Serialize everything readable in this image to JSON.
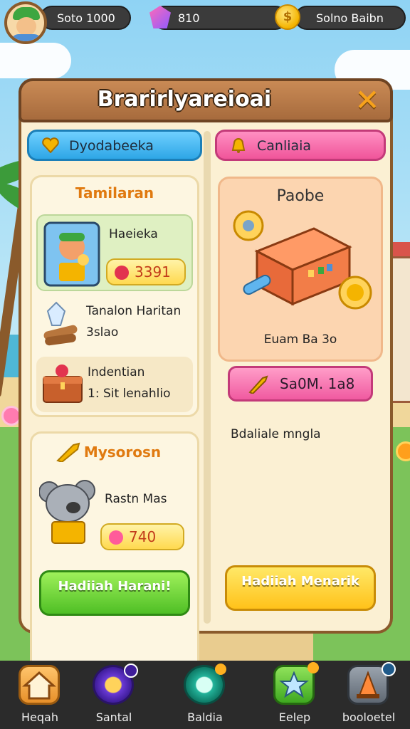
{
  "topbar": {
    "player_name": "Soto 1000",
    "gems": "810",
    "coins": "Solno Baibn"
  },
  "panel": {
    "title": "Brarirlyareioai",
    "close_label": "✕"
  },
  "left": {
    "tab_label": "Dyodabeeka",
    "section1_title": "Tamilaran",
    "item1_name": "Haeieka",
    "item1_price": "3391",
    "item2_name": "Tanalon Haritan",
    "item2_sub": "3slao",
    "item3_name": "Indentian",
    "item3_sub": "1: Sit lenahlio",
    "section2_title": "Mysorosn",
    "item4_name": "Rastn Mas",
    "item4_price": "740",
    "button_label": "Hadiiah Harani!"
  },
  "right": {
    "tab_label": "Canliaia",
    "feature_title": "Paobe",
    "feature_sub": "Euam Ba 3o",
    "pink_button_label": "Sa0M. 1a8",
    "note": "Bdaliale mngla",
    "button_label": "Hadiiah Menarik"
  },
  "nav": {
    "items": [
      {
        "label": "Heqah"
      },
      {
        "label": "Santal"
      },
      {
        "label": "Baldia"
      },
      {
        "label": "Eelep"
      },
      {
        "label": "booloetel"
      }
    ]
  },
  "colors": {
    "panel_bg": "#fbf0d3",
    "panel_border": "#8a5a2b",
    "accent_green": "#4fbf25",
    "accent_yellow": "#ffc21a",
    "accent_pink": "#f05aa0",
    "accent_blue": "#2ea6e6"
  },
  "icons": {
    "avatar": "player-avatar",
    "gem": "gem-icon",
    "coin": "coin-icon",
    "close": "close-icon",
    "nav": [
      "home-icon",
      "compass-icon",
      "chat-icon",
      "star-icon",
      "cone-icon"
    ]
  }
}
